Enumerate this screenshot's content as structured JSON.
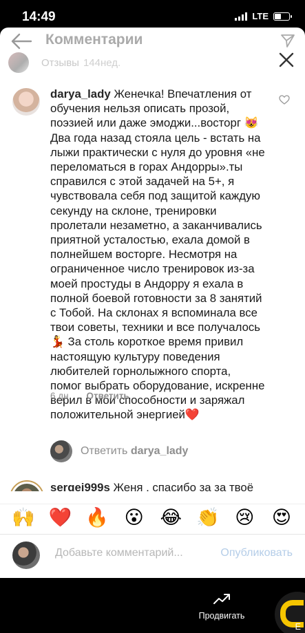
{
  "status_bar": {
    "time": "14:49",
    "network": "LTE"
  },
  "header": {
    "title": "Комментарии",
    "story_label": "Отзывы",
    "story_age": "144нед."
  },
  "comments": [
    {
      "username": "darya_lady",
      "text": "Женечка! Впечатления от обучения нельзя описать прозой, поэзией или даже эмоджи...восторг 😻 Два года назад стояла цель - встать на лыжи практически с нуля до уровня «не переломаться в горах Андорры».ты справился с этой задачей на 5+, я чувствовала себя под защитой каждую секунду на склоне, тренировки пролетали незаметно, а заканчивались приятной усталостью, ехала домой в полнейшем восторге. Несмотря на ограниченное число тренировок из-за моей простуды в Андорру я ехала в полной боевой готовности за 8 занятий с Тобой. На склонах я вспоминала все твои советы, техники и все получалось 💃 За столь короткое время привил настоящую культуру поведения любителей горнолыжного спорта, помог выбрать оборудование, искренне верил в мои способности и заряжал положительной энергией❤️",
      "age": "6 дн.",
      "reply_label": "Ответить"
    },
    {
      "username": "sergei999s",
      "text": "Женя , спасибо за за твоё время и обучение каталке на лыжах. Стояла цель обучения техники"
    }
  ],
  "reply_prompt": {
    "prefix": "Ответить",
    "username": "darya_lady"
  },
  "emoji_bar": [
    "🙌",
    "❤️",
    "🔥",
    "😮",
    "😂",
    "👏",
    "😢",
    "😍"
  ],
  "input": {
    "placeholder": "Добавьте комментарий...",
    "publish_label": "Опубликовать"
  },
  "bottom_bar": {
    "promote_label": "Продвигать",
    "corner_label": "Е"
  },
  "colors": {
    "sheet": "#ffffff",
    "link_blue_disabled": "#b4cde8",
    "heart_red": "#ed4956",
    "app_yellow": "#f5c500"
  }
}
